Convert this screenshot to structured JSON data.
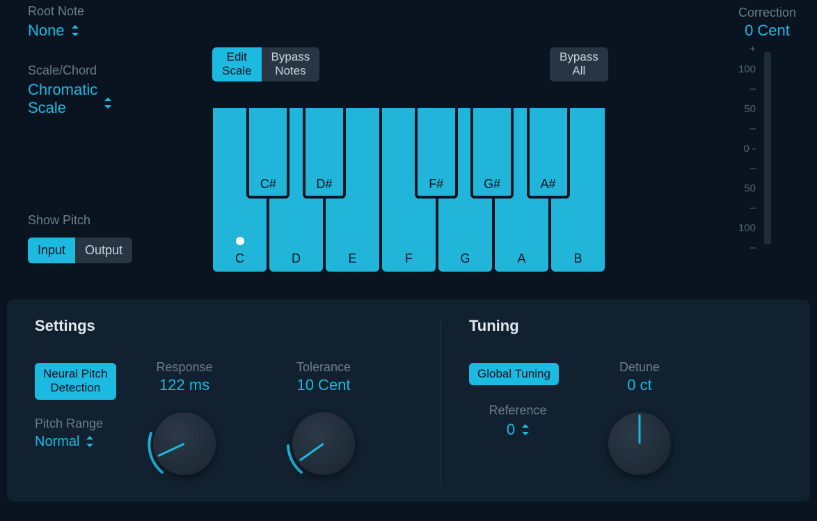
{
  "root_note": {
    "label": "Root Note",
    "value": "None"
  },
  "scale_chord": {
    "label": "Scale/Chord",
    "value": "Chromatic\nScale"
  },
  "show_pitch": {
    "label": "Show Pitch",
    "input": "Input",
    "output": "Output"
  },
  "center_seg": {
    "edit_scale": "Edit\nScale",
    "bypass_notes": "Bypass\nNotes"
  },
  "bypass_all": "Bypass\nAll",
  "keyboard": {
    "white": [
      "C",
      "D",
      "E",
      "F",
      "G",
      "A",
      "B"
    ],
    "black": [
      "C#",
      "D#",
      "F#",
      "G#",
      "A#"
    ],
    "input_note": "C"
  },
  "correction": {
    "label": "Correction",
    "value": "0 Cent",
    "scale": [
      "+",
      "100",
      "–",
      "50",
      "–",
      "0 -",
      "–",
      "50",
      "–",
      "100",
      "–"
    ]
  },
  "settings": {
    "title": "Settings",
    "neural": "Neural Pitch\nDetection",
    "response": {
      "label": "Response",
      "value": "122 ms",
      "angle": -115
    },
    "tolerance": {
      "label": "Tolerance",
      "value": "10 Cent",
      "angle": -125
    },
    "pitch_range": {
      "label": "Pitch Range",
      "value": "Normal"
    }
  },
  "tuning": {
    "title": "Tuning",
    "global": "Global Tuning",
    "reference": {
      "label": "Reference",
      "value": "0"
    },
    "detune": {
      "label": "Detune",
      "value": "0 ct",
      "angle": 0
    }
  }
}
